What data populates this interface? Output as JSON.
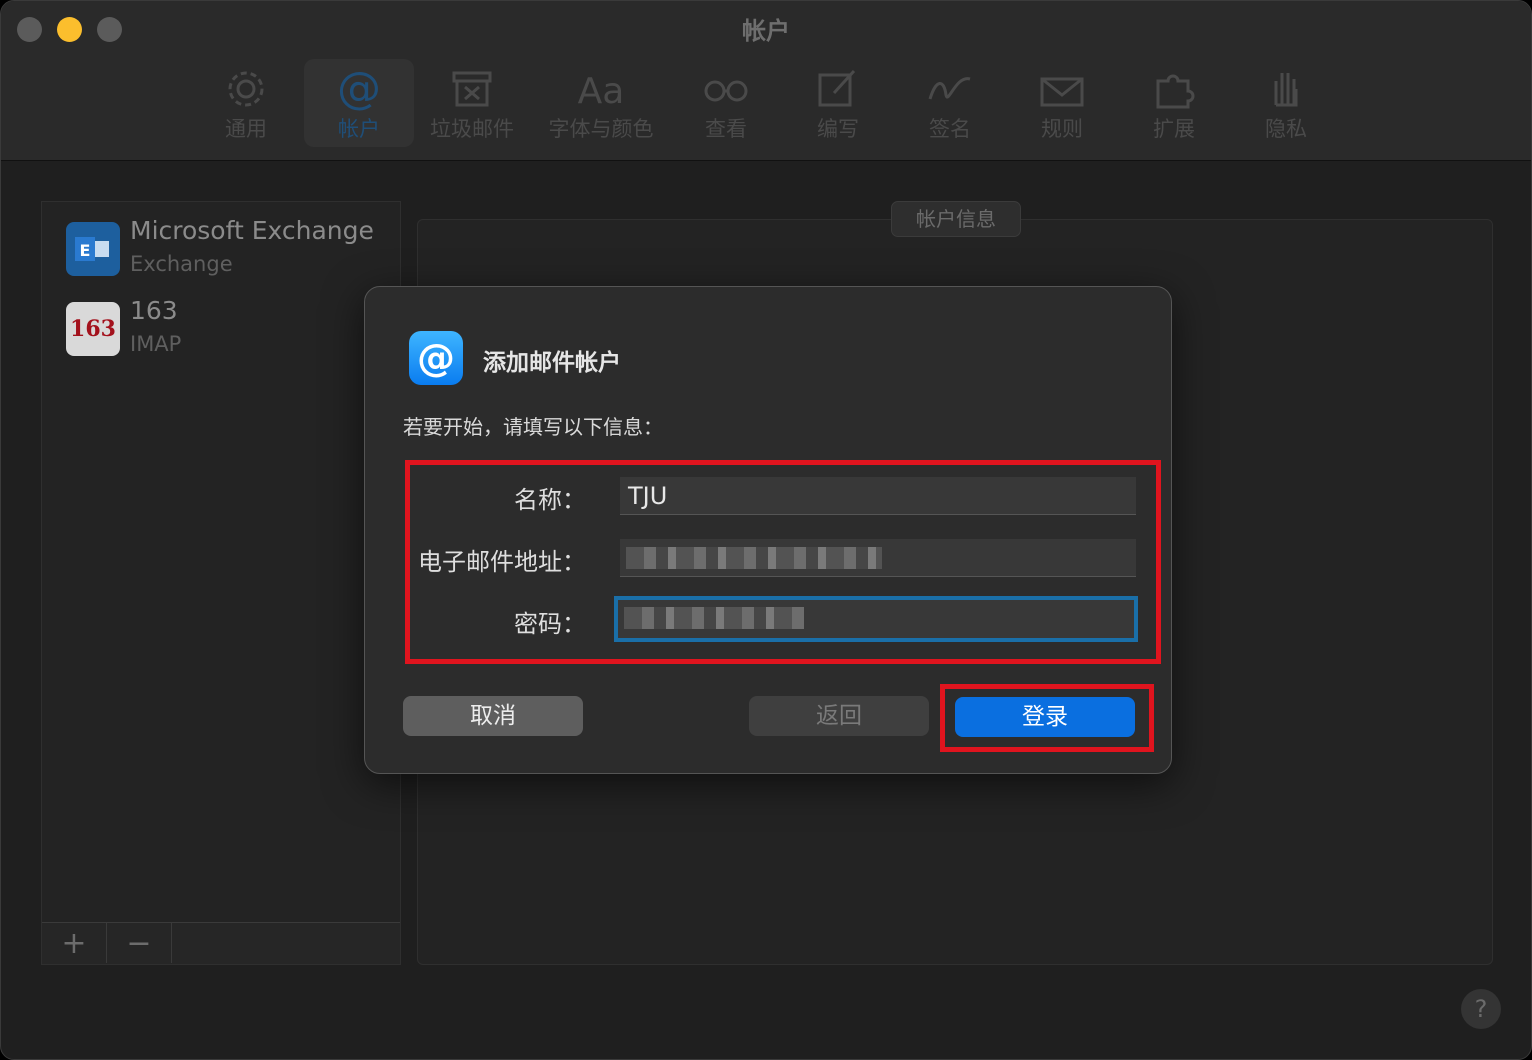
{
  "window": {
    "title": "帐户"
  },
  "toolbar": {
    "items": [
      {
        "label": "通用",
        "icon": "gear-icon"
      },
      {
        "label": "帐户",
        "icon": "at-sign-icon",
        "active": true
      },
      {
        "label": "垃圾邮件",
        "icon": "junk-bin-icon"
      },
      {
        "label": "字体与颜色",
        "icon": "font-icon",
        "glyph": "Aa"
      },
      {
        "label": "查看",
        "icon": "glasses-icon"
      },
      {
        "label": "编写",
        "icon": "compose-icon"
      },
      {
        "label": "签名",
        "icon": "signature-icon"
      },
      {
        "label": "规则",
        "icon": "rules-envelope-icon"
      },
      {
        "label": "扩展",
        "icon": "puzzle-icon"
      },
      {
        "label": "隐私",
        "icon": "hand-icon"
      }
    ]
  },
  "sidebar": {
    "accounts": [
      {
        "name": "Microsoft Exchange",
        "type": "Exchange",
        "icon": "exchange-icon"
      },
      {
        "name": "163",
        "type": "IMAP",
        "icon": "163-icon",
        "icon_text": "163"
      }
    ],
    "add_label": "+",
    "remove_label": "−"
  },
  "info_panel": {
    "tab_label": "帐户信息"
  },
  "dialog": {
    "title": "添加邮件帐户",
    "subtitle": "若要开始，请填写以下信息：",
    "fields": {
      "name_label": "名称：",
      "name_value": "TJU",
      "email_label": "电子邮件地址：",
      "password_label": "密码："
    },
    "buttons": {
      "cancel": "取消",
      "back": "返回",
      "login": "登录"
    }
  },
  "help": {
    "label": "?"
  },
  "colors": {
    "accent": "#0a6fe0",
    "highlight": "#e0141e",
    "focus": "#1a6fa8"
  }
}
